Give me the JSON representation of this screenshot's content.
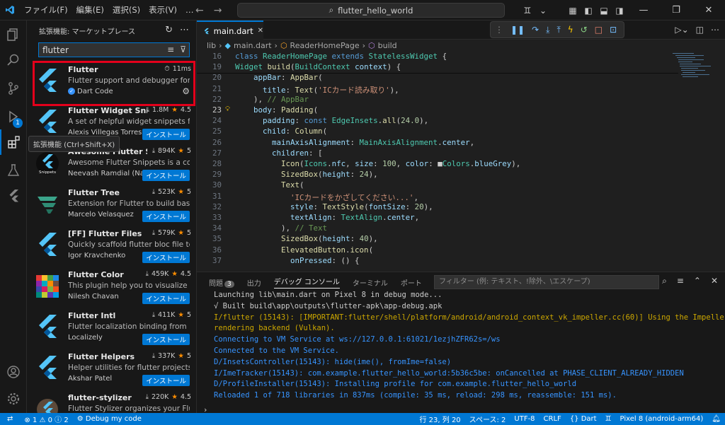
{
  "titlebar": {
    "menu": [
      "ファイル(F)",
      "編集(E)",
      "選択(S)",
      "表示(V)",
      "…"
    ],
    "search": "flutter_hello_world"
  },
  "activity": {
    "run_badge": "1",
    "tooltip": "拡張機能 (Ctrl+Shift+X)"
  },
  "sidebar": {
    "title": "拡張機能: マーケットプレース",
    "search_value": "flutter",
    "install_label": "インストール",
    "extensions": [
      {
        "name": "Flutter",
        "desc": "Flutter support and debugger for Vi...",
        "publisher": "Dart Code",
        "meta": "11ms",
        "installed": true
      },
      {
        "name": "Flutter Widget Snip...",
        "desc": "A set of helpful widget snippets for ...",
        "publisher": "Alexis Villegas Torres",
        "downloads": "1.8M",
        "rating": "4.5"
      },
      {
        "name": "Awesome Flutter Sni...",
        "desc": "Awesome Flutter Snippets is a colle...",
        "publisher": "Neevash Ramdial (Nash)",
        "downloads": "894K",
        "rating": "5"
      },
      {
        "name": "Flutter Tree",
        "desc": "Extension for Flutter to build basic ...",
        "publisher": "Marcelo Velasquez",
        "downloads": "523K",
        "rating": "5"
      },
      {
        "name": "[FF] Flutter Files",
        "desc": "Quickly scaffold flutter bloc file tem...",
        "publisher": "Igor Kravchenko",
        "downloads": "579K",
        "rating": "5"
      },
      {
        "name": "Flutter Color",
        "desc": "This plugin help you to visualize the...",
        "publisher": "Nilesh Chavan",
        "downloads": "459K",
        "rating": "4.5"
      },
      {
        "name": "Flutter Intl",
        "desc": "Flutter localization binding from .ar...",
        "publisher": "Localizely",
        "downloads": "411K",
        "rating": "5"
      },
      {
        "name": "Flutter Helpers",
        "desc": "Helper utilities for flutter projects",
        "publisher": "Akshar Patel",
        "downloads": "337K",
        "rating": "5"
      },
      {
        "name": "flutter-stylizer",
        "desc": "Flutter Stylizer organizes your Flutter...",
        "publisher": "",
        "downloads": "220K",
        "rating": "4.5"
      }
    ]
  },
  "editor": {
    "tab_label": "main.dart",
    "breadcrumb": [
      "lib",
      "main.dart",
      "ReaderHomePage",
      "build"
    ],
    "sticky": [
      {
        "n": "16",
        "tokens": [
          [
            "kw",
            "class "
          ],
          [
            "ty",
            "ReaderHomePage "
          ],
          [
            "kw",
            "extends "
          ],
          [
            "ty",
            "StatelessWidget "
          ],
          [
            "",
            "{"
          ]
        ]
      },
      {
        "n": "19",
        "tokens": [
          [
            "",
            ""
          ],
          [
            "ty",
            "Widget "
          ],
          [
            "fn",
            "build"
          ],
          [
            "",
            "("
          ],
          [
            "ty",
            "BuildContext "
          ],
          [
            "pr",
            "context"
          ],
          [
            "",
            ") {"
          ]
        ]
      }
    ],
    "lines": [
      {
        "n": "20",
        "tokens": [
          [
            "",
            "    "
          ],
          [
            "pr",
            "appBar"
          ],
          [
            "",
            ": "
          ],
          [
            "fn",
            "AppBar"
          ],
          [
            "",
            "("
          ]
        ]
      },
      {
        "n": "21",
        "tokens": [
          [
            "",
            "      "
          ],
          [
            "pr",
            "title"
          ],
          [
            "",
            ": "
          ],
          [
            "fn",
            "Text"
          ],
          [
            "",
            "("
          ],
          [
            "st",
            "'ICカード読み取り'"
          ],
          [
            "",
            "),"
          ]
        ]
      },
      {
        "n": "22",
        "tokens": [
          [
            "",
            "    ), "
          ],
          [
            "cm",
            "// AppBar"
          ]
        ]
      },
      {
        "n": "23",
        "tokens": [
          [
            "",
            "    "
          ],
          [
            "pr",
            "body"
          ],
          [
            "",
            ": "
          ],
          [
            "fn",
            "Padding"
          ],
          [
            "",
            "("
          ]
        ]
      },
      {
        "n": "24",
        "tokens": [
          [
            "",
            "      "
          ],
          [
            "pr",
            "padding"
          ],
          [
            "",
            ": "
          ],
          [
            "kw",
            "const "
          ],
          [
            "ty",
            "EdgeInsets"
          ],
          [
            "",
            "."
          ],
          [
            "fn",
            "all"
          ],
          [
            "",
            "("
          ],
          [
            "nm",
            "24.0"
          ],
          [
            "",
            "),"
          ]
        ]
      },
      {
        "n": "25",
        "tokens": [
          [
            "",
            "      "
          ],
          [
            "pr",
            "child"
          ],
          [
            "",
            ": "
          ],
          [
            "fn",
            "Column"
          ],
          [
            "",
            "("
          ]
        ]
      },
      {
        "n": "26",
        "tokens": [
          [
            "",
            "        "
          ],
          [
            "pr",
            "mainAxisAlignment"
          ],
          [
            "",
            ": "
          ],
          [
            "ty",
            "MainAxisAlignment"
          ],
          [
            "",
            "."
          ],
          [
            "pr",
            "center"
          ],
          [
            "",
            ","
          ]
        ]
      },
      {
        "n": "27",
        "tokens": [
          [
            "",
            "        "
          ],
          [
            "pr",
            "children"
          ],
          [
            "",
            ": ["
          ]
        ]
      },
      {
        "n": "28",
        "tokens": [
          [
            "",
            "          "
          ],
          [
            "fn",
            "Icon"
          ],
          [
            "",
            "("
          ],
          [
            "ty",
            "Icons"
          ],
          [
            "",
            "."
          ],
          [
            "pr",
            "nfc"
          ],
          [
            "",
            ", "
          ],
          [
            "pr",
            "size"
          ],
          [
            "",
            ": "
          ],
          [
            "nm",
            "100"
          ],
          [
            "",
            ", "
          ],
          [
            "pr",
            "color"
          ],
          [
            "",
            ": ■"
          ],
          [
            "ty",
            "Colors"
          ],
          [
            "",
            "."
          ],
          [
            "pr",
            "blueGrey"
          ],
          [
            "",
            "),"
          ]
        ]
      },
      {
        "n": "29",
        "tokens": [
          [
            "",
            "          "
          ],
          [
            "fn",
            "SizedBox"
          ],
          [
            "",
            "("
          ],
          [
            "pr",
            "height"
          ],
          [
            "",
            ": "
          ],
          [
            "nm",
            "24"
          ],
          [
            "",
            "),"
          ]
        ]
      },
      {
        "n": "30",
        "tokens": [
          [
            "",
            "          "
          ],
          [
            "fn",
            "Text"
          ],
          [
            "",
            "("
          ]
        ]
      },
      {
        "n": "31",
        "tokens": [
          [
            "",
            "            "
          ],
          [
            "st",
            "'ICカードをかざしてください...'"
          ],
          [
            "",
            ","
          ]
        ]
      },
      {
        "n": "32",
        "tokens": [
          [
            "",
            "            "
          ],
          [
            "pr",
            "style"
          ],
          [
            "",
            ": "
          ],
          [
            "fn",
            "TextStyle"
          ],
          [
            "",
            "("
          ],
          [
            "pr",
            "fontSize"
          ],
          [
            "",
            ": "
          ],
          [
            "nm",
            "20"
          ],
          [
            "",
            "),"
          ]
        ]
      },
      {
        "n": "33",
        "tokens": [
          [
            "",
            "            "
          ],
          [
            "pr",
            "textAlign"
          ],
          [
            "",
            ": "
          ],
          [
            "ty",
            "TextAlign"
          ],
          [
            "",
            "."
          ],
          [
            "pr",
            "center"
          ],
          [
            "",
            ","
          ]
        ]
      },
      {
        "n": "34",
        "tokens": [
          [
            "",
            "          ), "
          ],
          [
            "cm",
            "// Text"
          ]
        ]
      },
      {
        "n": "35",
        "tokens": [
          [
            "",
            "          "
          ],
          [
            "fn",
            "SizedBox"
          ],
          [
            "",
            "("
          ],
          [
            "pr",
            "height"
          ],
          [
            "",
            ": "
          ],
          [
            "nm",
            "40"
          ],
          [
            "",
            "),"
          ]
        ]
      },
      {
        "n": "36",
        "tokens": [
          [
            "",
            "          "
          ],
          [
            "fn",
            "ElevatedButton"
          ],
          [
            "",
            "."
          ],
          [
            "fn",
            "icon"
          ],
          [
            "",
            "("
          ]
        ]
      },
      {
        "n": "37",
        "tokens": [
          [
            "",
            "            "
          ],
          [
            "pr",
            "onPressed"
          ],
          [
            "",
            ": () {"
          ]
        ]
      }
    ]
  },
  "panel": {
    "tabs": [
      "問題",
      "出力",
      "デバッグ コンソール",
      "ターミナル",
      "ポート"
    ],
    "problems_count": "3",
    "filter_placeholder": "フィルター (例: テキスト、!除外、\\エスケープ)",
    "console": [
      {
        "c": "c-gray",
        "t": "Launching lib\\main.dart on Pixel 8 in debug mode..."
      },
      {
        "c": "c-gray",
        "t": "√ Built build\\app\\outputs\\flutter-apk\\app-debug.apk"
      },
      {
        "c": "c-yellow",
        "t": "I/flutter (15143): [IMPORTANT:flutter/shell/platform/android/android_context_vk_impeller.cc(60)] Using the Impeller"
      },
      {
        "c": "c-yellow",
        "t": "rendering backend (Vulkan)."
      },
      {
        "c": "c-blue",
        "t": "Connecting to VM Service at ws://127.0.0.1:61021/1ezjhZFR62s=/ws"
      },
      {
        "c": "c-blue",
        "t": "Connected to the VM Service."
      },
      {
        "c": "c-blue",
        "t": "D/InsetsController(15143): hide(ime(), fromIme=false)"
      },
      {
        "c": "c-blue",
        "t": "I/ImeTracker(15143): com.example.flutter_hello_world:5b36c5be: onCancelled at PHASE_CLIENT_ALREADY_HIDDEN"
      },
      {
        "c": "c-blue",
        "t": "D/ProfileInstaller(15143): Installing profile for com.example.flutter_hello_world"
      },
      {
        "c": "c-blue",
        "t": "Reloaded 1 of 718 libraries in 837ms (compile: 35 ms, reload: 298 ms, reassemble: 151 ms)."
      }
    ]
  },
  "statusbar": {
    "problems": "⊗ 1 ⚠ 0 ⓘ 2",
    "debug": "Debug my code",
    "position": "行 23, 列 20",
    "spaces": "スペース: 2",
    "encoding": "UTF-8",
    "eol": "CRLF",
    "language": "{} Dart",
    "device": "Pixel 8 (android-arm64)"
  },
  "colors": {
    "accent": "#0078d4",
    "highlight": "#e3001b",
    "flutter_blue": "#54c5f8"
  }
}
